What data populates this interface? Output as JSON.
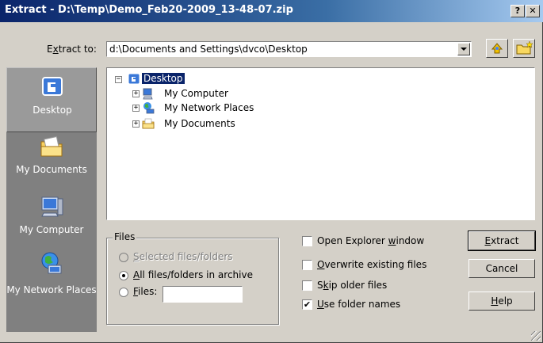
{
  "window": {
    "title": "Extract - D:\\Temp\\Demo_Feb20-2009_13-48-07.zip",
    "help_btn": "?",
    "close_btn": "✕"
  },
  "extract_to": {
    "label_pre": "E",
    "label_u": "x",
    "label_post": "tract to:",
    "path": "d:\\Documents and Settings\\dvco\\Desktop"
  },
  "sidebar": {
    "items": [
      {
        "label": "Desktop",
        "icon": "desktop-icon"
      },
      {
        "label": "My Documents",
        "icon": "folder-icon"
      },
      {
        "label": "My Computer",
        "icon": "computer-icon"
      },
      {
        "label": "My Network Places",
        "icon": "network-icon"
      }
    ]
  },
  "tree": {
    "root": {
      "label": "Desktop",
      "expander": "−"
    },
    "children": [
      {
        "label": "My Computer",
        "expander": "+",
        "icon": "computer-icon"
      },
      {
        "label": "My Network Places",
        "expander": "+",
        "icon": "network-icon"
      },
      {
        "label": "My Documents",
        "expander": "+",
        "icon": "folder-icon"
      }
    ]
  },
  "files_group": {
    "title": "Files",
    "opt_selected_u": "S",
    "opt_selected_rest": "elected files/folders",
    "opt_all_u": "A",
    "opt_all_rest": "ll files/folders in archive",
    "opt_files_u": "F",
    "opt_files_rest": "iles:",
    "files_value": "",
    "selected_option": "all"
  },
  "options": [
    {
      "pre": "Open Explorer ",
      "u": "w",
      "post": "indow",
      "checked": false
    },
    {
      "pre": "",
      "u": "O",
      "post": "verwrite existing files",
      "checked": false
    },
    {
      "pre": "S",
      "u": "k",
      "post": "ip older files",
      "checked": false
    },
    {
      "pre": "",
      "u": "U",
      "post": "se folder names",
      "checked": true
    }
  ],
  "buttons": {
    "extract_u": "E",
    "extract_rest": "xtract",
    "cancel": "Cancel",
    "help_u": "H",
    "help_rest": "elp"
  },
  "checkmark": "✔",
  "colors": {
    "titlebar": "#0a246a",
    "face": "#d4d0c8",
    "sidebar": "#808080",
    "selection": "#0a246a"
  }
}
